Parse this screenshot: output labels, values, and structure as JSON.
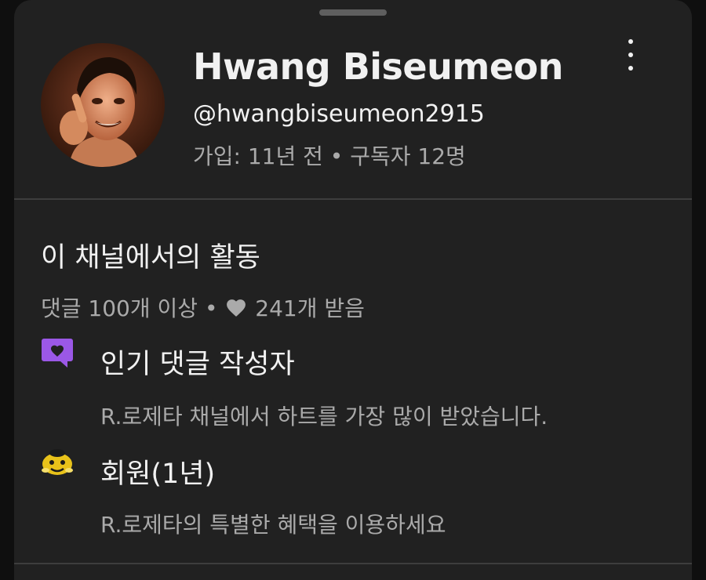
{
  "channel": {
    "name": "Hwang Biseumeon",
    "handle": "@hwangbiseumeon2915",
    "meta": "가입: 11년 전 • 구독자 12명"
  },
  "activity": {
    "title": "이 채널에서의 활동",
    "stats_prefix": "댓글 100개 이상 •",
    "stats_suffix": "241개 받음"
  },
  "badges": [
    {
      "icon": "purple-heart-comment-icon",
      "title": "인기 댓글 작성자",
      "description": "R.로제타 채널에서 하트를 가장 많이 받았습니다."
    },
    {
      "icon": "membership-badge-icon",
      "title": "회원(1년)",
      "description": "R.로제타의 특별한 혜택을 이용하세요"
    }
  ],
  "colors": {
    "background": "#212121",
    "text_primary": "#f1f1f1",
    "text_secondary": "#aaaaaa",
    "accent_purple": "#9b58e6",
    "badge_yellow": "#e8c21a"
  }
}
